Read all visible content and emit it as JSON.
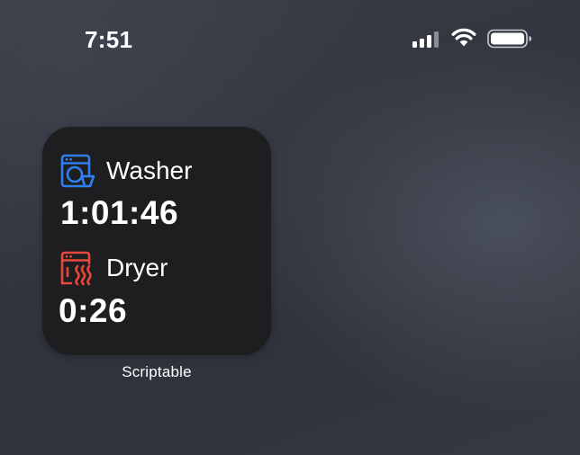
{
  "status_bar": {
    "time": "7:51",
    "signal_icon": "cellular-signal-icon",
    "wifi_icon": "wifi-icon",
    "battery_icon": "battery-icon"
  },
  "widget": {
    "app_name": "Scriptable",
    "background_color": "#1e1e20",
    "washer": {
      "name": "Washer",
      "time": "1:01:46",
      "icon": "washing-machine-icon",
      "color": "#2f7ff2"
    },
    "dryer": {
      "name": "Dryer",
      "time": "0:26",
      "icon": "dryer-icon",
      "color": "#e8473c"
    }
  }
}
